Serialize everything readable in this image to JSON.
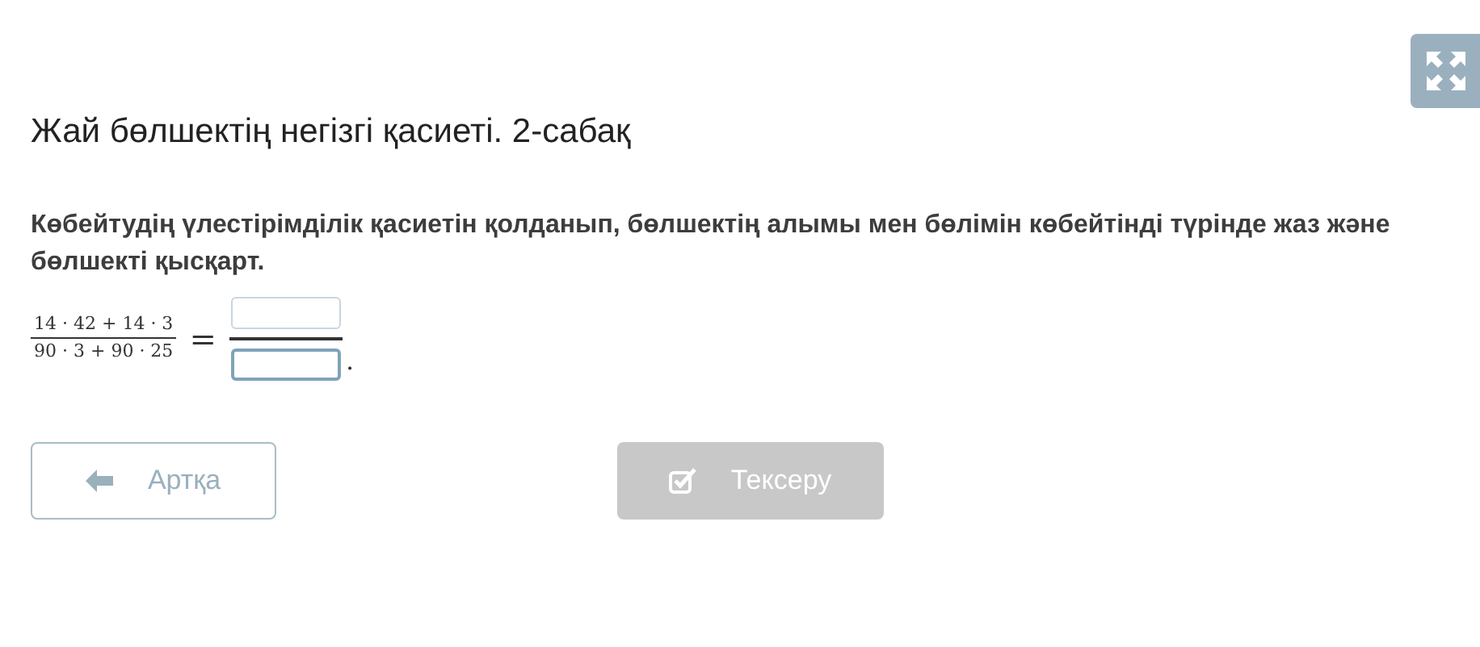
{
  "title": "Жай бөлшектің негізгі қасиеті. 2-сабақ",
  "question": "Көбейтудің үлестірімділік қасиетін қолданып, бөлшектің алымы мен бөлімін көбейтінді түрінде жаз және бөлшекті қысқарт.",
  "expression": {
    "numerator": "14 · 42 + 14 · 3",
    "denominator": "90 · 3 + 90 · 25",
    "equals": "=",
    "end": ".",
    "fields": [
      {
        "focused": false
      },
      {
        "focused": true
      }
    ]
  },
  "buttons": [
    {
      "kind": "back",
      "label": "Артқа",
      "disabled": false
    },
    {
      "kind": "check",
      "label": "Тексеру",
      "disabled": true
    }
  ]
}
